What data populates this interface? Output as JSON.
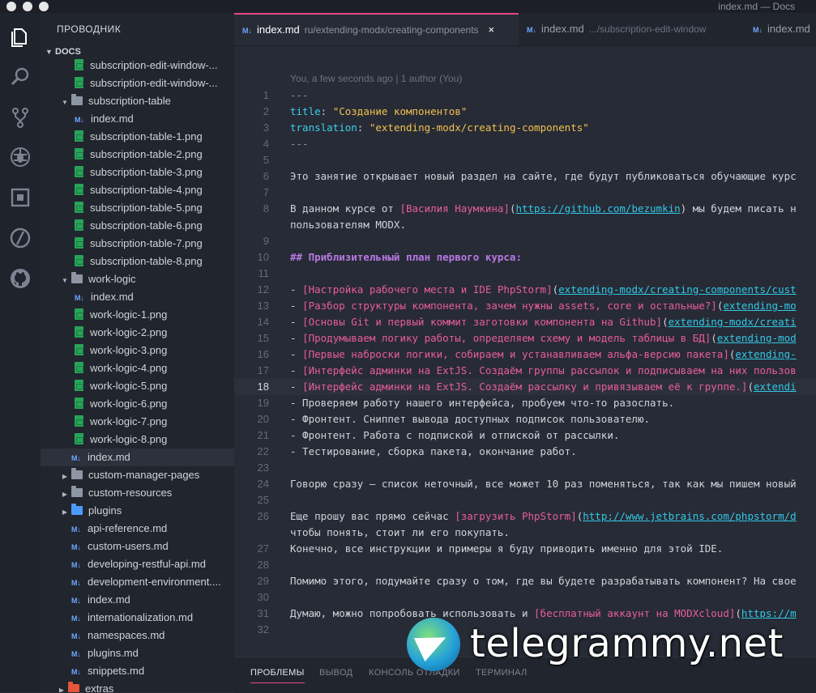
{
  "window": {
    "title": "index.md — Docs"
  },
  "activity_bar": [
    "files-icon",
    "search-icon",
    "source-control-icon",
    "debug-icon",
    "extensions-icon",
    "no-entry-icon",
    "github-icon"
  ],
  "sidebar": {
    "title": "ПРОВОДНИК",
    "section": "DOCS",
    "rows": [
      {
        "label": "subscription-edit-window-...",
        "type": "png",
        "indent": 2,
        "arrow": ""
      },
      {
        "label": "subscription-edit-window-...",
        "type": "png",
        "indent": 2,
        "arrow": ""
      },
      {
        "label": "subscription-table",
        "type": "folder",
        "indent": 1,
        "arrow": "open"
      },
      {
        "label": "index.md",
        "type": "md",
        "indent": 2,
        "arrow": ""
      },
      {
        "label": "subscription-table-1.png",
        "type": "png",
        "indent": 2,
        "arrow": ""
      },
      {
        "label": "subscription-table-2.png",
        "type": "png",
        "indent": 2,
        "arrow": ""
      },
      {
        "label": "subscription-table-3.png",
        "type": "png",
        "indent": 2,
        "arrow": ""
      },
      {
        "label": "subscription-table-4.png",
        "type": "png",
        "indent": 2,
        "arrow": ""
      },
      {
        "label": "subscription-table-5.png",
        "type": "png",
        "indent": 2,
        "arrow": ""
      },
      {
        "label": "subscription-table-6.png",
        "type": "png",
        "indent": 2,
        "arrow": ""
      },
      {
        "label": "subscription-table-7.png",
        "type": "png",
        "indent": 2,
        "arrow": ""
      },
      {
        "label": "subscription-table-8.png",
        "type": "png",
        "indent": 2,
        "arrow": ""
      },
      {
        "label": "work-logic",
        "type": "folder",
        "indent": 1,
        "arrow": "open"
      },
      {
        "label": "index.md",
        "type": "md",
        "indent": 2,
        "arrow": ""
      },
      {
        "label": "work-logic-1.png",
        "type": "png",
        "indent": 2,
        "arrow": ""
      },
      {
        "label": "work-logic-2.png",
        "type": "png",
        "indent": 2,
        "arrow": ""
      },
      {
        "label": "work-logic-3.png",
        "type": "png",
        "indent": 2,
        "arrow": ""
      },
      {
        "label": "work-logic-4.png",
        "type": "png",
        "indent": 2,
        "arrow": ""
      },
      {
        "label": "work-logic-5.png",
        "type": "png",
        "indent": 2,
        "arrow": ""
      },
      {
        "label": "work-logic-6.png",
        "type": "png",
        "indent": 2,
        "arrow": ""
      },
      {
        "label": "work-logic-7.png",
        "type": "png",
        "indent": 2,
        "arrow": ""
      },
      {
        "label": "work-logic-8.png",
        "type": "png",
        "indent": 2,
        "arrow": ""
      },
      {
        "label": "index.md",
        "type": "md",
        "indent": 1,
        "arrow": "",
        "selected": true
      },
      {
        "label": "custom-manager-pages",
        "type": "folder",
        "indent": 0,
        "arrow": "closed"
      },
      {
        "label": "custom-resources",
        "type": "folder",
        "indent": 0,
        "arrow": "closed"
      },
      {
        "label": "plugins",
        "type": "plugin-folder",
        "indent": 0,
        "arrow": "closed"
      },
      {
        "label": "api-reference.md",
        "type": "md",
        "indent": 0,
        "arrow": ""
      },
      {
        "label": "custom-users.md",
        "type": "md",
        "indent": 0,
        "arrow": ""
      },
      {
        "label": "developing-restful-api.md",
        "type": "md",
        "indent": 0,
        "arrow": ""
      },
      {
        "label": "development-environment....",
        "type": "md",
        "indent": 0,
        "arrow": ""
      },
      {
        "label": "index.md",
        "type": "md",
        "indent": 0,
        "arrow": ""
      },
      {
        "label": "internationalization.md",
        "type": "md",
        "indent": 0,
        "arrow": ""
      },
      {
        "label": "namespaces.md",
        "type": "md",
        "indent": 0,
        "arrow": ""
      },
      {
        "label": "plugins.md",
        "type": "md",
        "indent": 0,
        "arrow": ""
      },
      {
        "label": "snippets.md",
        "type": "md",
        "indent": 0,
        "arrow": ""
      },
      {
        "label": "extras",
        "type": "extras-folder",
        "indent": -1,
        "arrow": "closed"
      }
    ]
  },
  "tabs": [
    {
      "icon": "M↓",
      "name": "index.md",
      "path": "ru/extending-modx/creating-components",
      "active": true,
      "close": "×"
    },
    {
      "icon": "M↓",
      "name": "index.md",
      "path": ".../subscription-edit-window",
      "active": false
    },
    {
      "icon": "M↓",
      "name": "index.md",
      "path": "",
      "active": false
    }
  ],
  "editor": {
    "blame": "You, a few seconds ago | 1 author (You)",
    "current_line": 18,
    "lines": [
      {
        "n": "1",
        "parts": [
          [
            "sep",
            "---"
          ]
        ]
      },
      {
        "n": "2",
        "parts": [
          [
            "key",
            "title"
          ],
          [
            "plain",
            ": "
          ],
          [
            "str",
            "\"Создание компонентов\""
          ]
        ]
      },
      {
        "n": "3",
        "parts": [
          [
            "key",
            "translation"
          ],
          [
            "plain",
            ": "
          ],
          [
            "str",
            "\"extending-modx/creating-components\""
          ]
        ]
      },
      {
        "n": "4",
        "parts": [
          [
            "sep",
            "---"
          ]
        ]
      },
      {
        "n": "5",
        "parts": []
      },
      {
        "n": "6",
        "parts": [
          [
            "plain",
            "Это занятие открывает новый раздел на сайте, где будут публиковаться обучающие курс"
          ]
        ]
      },
      {
        "n": "7",
        "parts": []
      },
      {
        "n": "8",
        "parts": [
          [
            "plain",
            "В данном курсе от "
          ],
          [
            "link",
            "[Василия Наумкина]"
          ],
          [
            "plain",
            "("
          ],
          [
            "url",
            "https://github.com/bezumkin"
          ],
          [
            "plain",
            ") мы будем писать н"
          ]
        ]
      },
      {
        "n": "",
        "parts": [
          [
            "plain",
            "пользователям MODX."
          ]
        ]
      },
      {
        "n": "9",
        "parts": []
      },
      {
        "n": "10",
        "parts": [
          [
            "head",
            "## Приблизительный план первого курса:"
          ]
        ]
      },
      {
        "n": "11",
        "parts": []
      },
      {
        "n": "12",
        "parts": [
          [
            "plain",
            "- "
          ],
          [
            "link",
            "[Настройка рабочего места и IDE PhpStorm]"
          ],
          [
            "plain",
            "("
          ],
          [
            "url",
            "extending-modx/creating-components/cust"
          ]
        ]
      },
      {
        "n": "13",
        "parts": [
          [
            "plain",
            "- "
          ],
          [
            "link",
            "[Разбор структуры компонента, зачем нужны assets, core и остальные?]"
          ],
          [
            "plain",
            "("
          ],
          [
            "url",
            "extending-mo"
          ]
        ]
      },
      {
        "n": "14",
        "parts": [
          [
            "plain",
            "- "
          ],
          [
            "link",
            "[Основы Git и первый коммит заготовки компонента на Github]"
          ],
          [
            "plain",
            "("
          ],
          [
            "url",
            "extending-modx/creati"
          ]
        ]
      },
      {
        "n": "15",
        "parts": [
          [
            "plain",
            "- "
          ],
          [
            "link",
            "[Продумываем логику работы, определяем схему и модель таблицы в БД]"
          ],
          [
            "plain",
            "("
          ],
          [
            "url",
            "extending-mod"
          ]
        ]
      },
      {
        "n": "16",
        "parts": [
          [
            "plain",
            "- "
          ],
          [
            "link",
            "[Первые наброски логики, собираем и устанавливаем альфа-версию пакета]"
          ],
          [
            "plain",
            "("
          ],
          [
            "url",
            "extending-"
          ]
        ]
      },
      {
        "n": "17",
        "parts": [
          [
            "plain",
            "- "
          ],
          [
            "link",
            "[Интерфейс админки на ExtJS. Создаём группы рассылок и подписываем на них пользов"
          ]
        ]
      },
      {
        "n": "18",
        "parts": [
          [
            "plain",
            "- "
          ],
          [
            "link",
            "[Интерфейс админки на ExtJS. Создаём рассылку и привязываем её к группе.]"
          ],
          [
            "plain",
            "("
          ],
          [
            "url",
            "extendi"
          ]
        ]
      },
      {
        "n": "19",
        "parts": [
          [
            "plain",
            "- Проверяем работу нашего интерфейса, пробуем что-то разослать."
          ]
        ]
      },
      {
        "n": "20",
        "parts": [
          [
            "plain",
            "- Фронтент. Сниппет вывода доступных подписок пользователю."
          ]
        ]
      },
      {
        "n": "21",
        "parts": [
          [
            "plain",
            "- Фронтент. Работа с подпиской и отпиской от рассылки."
          ]
        ]
      },
      {
        "n": "22",
        "parts": [
          [
            "plain",
            "- Тестирование, сборка пакета, окончание работ."
          ]
        ]
      },
      {
        "n": "23",
        "parts": []
      },
      {
        "n": "24",
        "parts": [
          [
            "plain",
            "Говорю сразу — список неточный, все может 10 раз поменяться, так как мы пишем новый"
          ]
        ]
      },
      {
        "n": "25",
        "parts": []
      },
      {
        "n": "26",
        "parts": [
          [
            "plain",
            "Еще прошу вас прямо сейчас "
          ],
          [
            "link",
            "[загрузить PhpStorm]"
          ],
          [
            "plain",
            "("
          ],
          [
            "url",
            "http://www.jetbrains.com/phpstorm/d"
          ]
        ]
      },
      {
        "n": "",
        "parts": [
          [
            "plain",
            "чтобы понять, стоит ли его покупать."
          ]
        ]
      },
      {
        "n": "27",
        "parts": [
          [
            "plain",
            "Конечно, все инструкции и примеры я буду приводить именно для этой IDE."
          ]
        ]
      },
      {
        "n": "28",
        "parts": []
      },
      {
        "n": "29",
        "parts": [
          [
            "plain",
            "Помимо этого, подумайте сразу о том, где вы будете разрабатывать компонент? На свое"
          ]
        ]
      },
      {
        "n": "30",
        "parts": []
      },
      {
        "n": "31",
        "parts": [
          [
            "plain",
            "Думаю, можно попробовать использовать и "
          ],
          [
            "link",
            "[бесплатный аккаунт на MODXcloud]"
          ],
          [
            "plain",
            "("
          ],
          [
            "url",
            "https://m"
          ]
        ]
      },
      {
        "n": "32",
        "parts": []
      }
    ]
  },
  "panel": {
    "tabs": [
      "ПРОБЛЕМЫ",
      "ВЫВОД",
      "КОНСОЛЬ ОТЛАДКИ",
      "ТЕРМИНАЛ"
    ]
  },
  "watermark": {
    "text": "telegrammy.net"
  },
  "colors": {
    "accent": "#e64980",
    "key": "#3bd1ec",
    "string": "#f2c14e",
    "heading": "#b978e3",
    "link": "#e85d9c",
    "url": "#31c8e6"
  }
}
